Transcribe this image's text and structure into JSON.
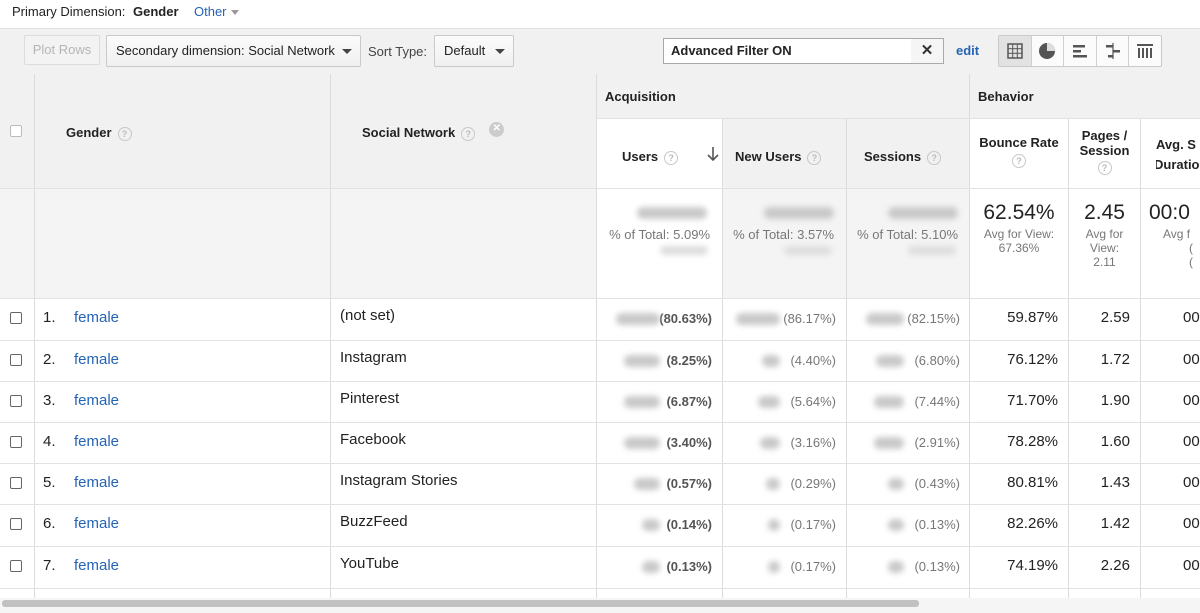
{
  "primary_dimension": {
    "label": "Primary Dimension:",
    "selected": "Gender",
    "other_label": "Other"
  },
  "toolbar": {
    "plot_rows": "Plot Rows",
    "secondary_dimension": "Secondary dimension: Social Network",
    "sort_type_label": "Sort Type:",
    "sort_type_value": "Default",
    "filter_value": "Advanced Filter ON",
    "filter_clear": "✕",
    "edit": "edit"
  },
  "view_modes": [
    "table-view-icon",
    "pie-view-icon",
    "performance-view-icon",
    "comparison-view-icon",
    "pivot-view-icon"
  ],
  "headers": {
    "gender": "Gender",
    "social_network": "Social Network",
    "acquisition": "Acquisition",
    "behavior": "Behavior",
    "users": "Users",
    "new_users": "New Users",
    "sessions": "Sessions",
    "bounce_rate": "Bounce Rate",
    "pages_session_line1": "Pages /",
    "pages_session_line2": "Session",
    "avg_duration_line1": "Avg. S",
    "avg_duration_line2": "Duratio"
  },
  "totals": {
    "users_pct": "% of Total: 5.09%",
    "new_users_pct": "% of Total: 3.57%",
    "sessions_pct": "% of Total: 5.10%",
    "bounce_rate": "62.54%",
    "bounce_rate_avg_line1": "Avg for View:",
    "bounce_rate_avg_line2": "67.36%",
    "pages_session": "2.45",
    "pages_avg_line1": "Avg for",
    "pages_avg_line2": "View:",
    "pages_avg_line3": "2.11",
    "avg_duration": "00:0",
    "avg_duration_sub1": "Avg f",
    "avg_duration_sub2": "(",
    "avg_duration_sub3": "("
  },
  "rows": [
    {
      "num": "1.",
      "gender": "female",
      "network": "(not set)",
      "users_pct": "(80.63%)",
      "new_users_pct": "(86.17%)",
      "sessions_pct": "(82.15%)",
      "bounce_rate": "59.87%",
      "pages_session": "2.59",
      "avg_duration": "00"
    },
    {
      "num": "2.",
      "gender": "female",
      "network": "Instagram",
      "users_pct": "(8.25%)",
      "new_users_pct": "(4.40%)",
      "sessions_pct": "(6.80%)",
      "bounce_rate": "76.12%",
      "pages_session": "1.72",
      "avg_duration": "00"
    },
    {
      "num": "3.",
      "gender": "female",
      "network": "Pinterest",
      "users_pct": "(6.87%)",
      "new_users_pct": "(5.64%)",
      "sessions_pct": "(7.44%)",
      "bounce_rate": "71.70%",
      "pages_session": "1.90",
      "avg_duration": "00"
    },
    {
      "num": "4.",
      "gender": "female",
      "network": "Facebook",
      "users_pct": "(3.40%)",
      "new_users_pct": "(3.16%)",
      "sessions_pct": "(2.91%)",
      "bounce_rate": "78.28%",
      "pages_session": "1.60",
      "avg_duration": "00"
    },
    {
      "num": "5.",
      "gender": "female",
      "network": "Instagram Stories",
      "users_pct": "(0.57%)",
      "new_users_pct": "(0.29%)",
      "sessions_pct": "(0.43%)",
      "bounce_rate": "80.81%",
      "pages_session": "1.43",
      "avg_duration": "00"
    },
    {
      "num": "6.",
      "gender": "female",
      "network": "BuzzFeed",
      "users_pct": "(0.14%)",
      "new_users_pct": "(0.17%)",
      "sessions_pct": "(0.13%)",
      "bounce_rate": "82.26%",
      "pages_session": "1.42",
      "avg_duration": "00"
    },
    {
      "num": "7.",
      "gender": "female",
      "network": "YouTube",
      "users_pct": "(0.13%)",
      "new_users_pct": "(0.17%)",
      "sessions_pct": "(0.13%)",
      "bounce_rate": "74.19%",
      "pages_session": "2.26",
      "avg_duration": "00"
    }
  ]
}
